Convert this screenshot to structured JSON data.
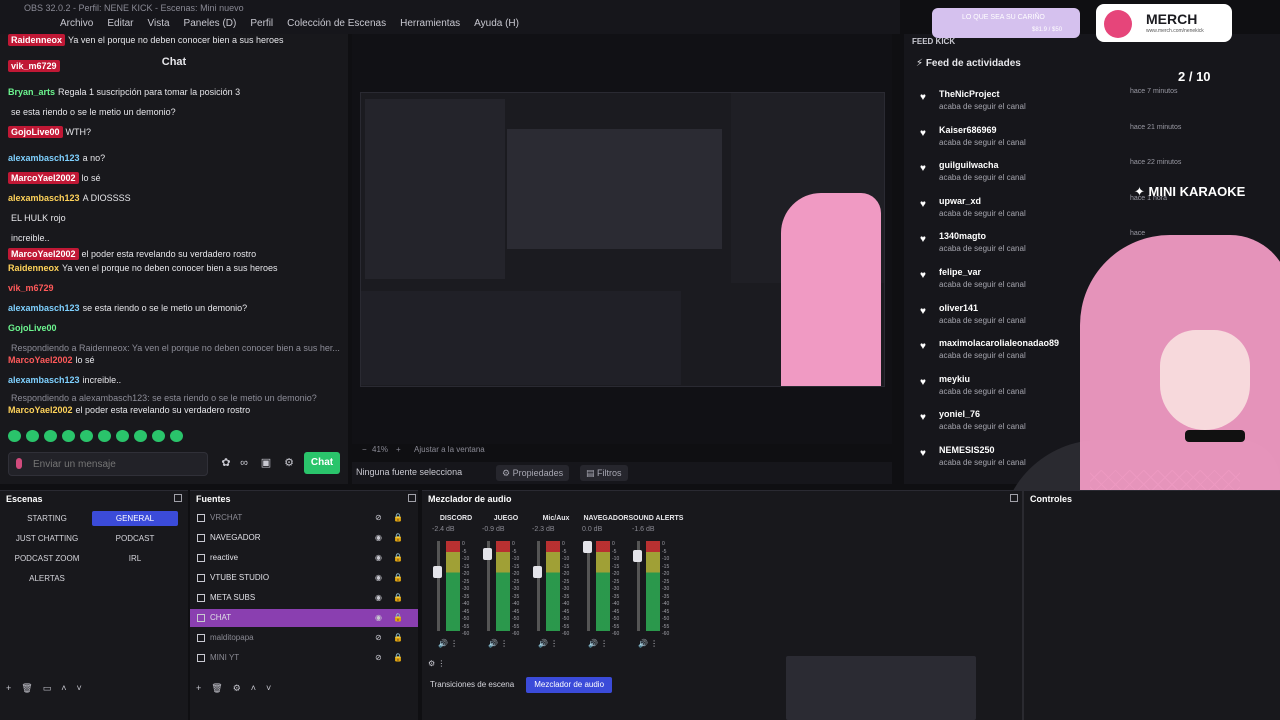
{
  "window_title": "OBS 32.0.2 - Perfil: NENE KICK - Escenas: Mini nuevo",
  "menu": [
    "Archivo",
    "Editar",
    "Vista",
    "Paneles (D)",
    "Perfil",
    "Colección de Escenas",
    "Herramientas",
    "Ayuda (H)"
  ],
  "chat": {
    "title": "Chat",
    "lines": [
      {
        "user": "Raidenneox",
        "text": "Ya ven el porque no deben conocer bien a sus heroes",
        "kind": "badge"
      },
      {
        "user": "vik_m6729",
        "text": "",
        "kind": "badge"
      },
      {
        "user": "Bryan_arts",
        "text": "Regala 1 suscripción para tomar la posición 3",
        "kind": "normal"
      },
      {
        "user": "",
        "text": "se esta riendo o se le metio un demonio?",
        "kind": "normal"
      },
      {
        "user": "GojoLive00",
        "text": "WTH?",
        "kind": "badge"
      },
      {
        "user": "alexambasch123",
        "text": "a no?",
        "kind": "normal"
      },
      {
        "user": "MarcoYael2002",
        "text": "lo sé",
        "kind": "badge"
      },
      {
        "user": "alexambasch123",
        "text": "A DIOSSSS",
        "kind": "normal"
      },
      {
        "user": "",
        "text": "EL HULK rojo",
        "kind": "normal"
      },
      {
        "user": "",
        "text": "increible..",
        "kind": "normal"
      },
      {
        "user": "MarcoYael2002",
        "text": "el poder esta revelando su verdadero rostro",
        "kind": "badge"
      },
      {
        "user": "Raidenneox",
        "text": "Ya ven el porque no deben conocer bien a sus heroes",
        "kind": "normal"
      },
      {
        "user": "vik_m6729",
        "text": "",
        "kind": "normal"
      },
      {
        "user": "alexambasch123",
        "text": "se esta riendo o se le metio un demonio?",
        "kind": "normal"
      },
      {
        "user": "GojoLive00",
        "text": "",
        "kind": "normal"
      },
      {
        "user": "",
        "text": "Respondiendo a Raidenneox: Ya ven el porque no deben conocer bien a sus her...",
        "kind": "reply"
      },
      {
        "user": "MarcoYael2002",
        "text": "lo sé",
        "kind": "normal"
      },
      {
        "user": "alexambasch123",
        "text": "increible..",
        "kind": "normal"
      },
      {
        "user": "",
        "text": "Respondiendo a alexambasch123: se esta riendo o se le metio un demonio?",
        "kind": "reply"
      },
      {
        "user": "MarcoYael2002",
        "text": "el poder esta revelando su verdadero rostro",
        "kind": "normal"
      }
    ],
    "input_placeholder": "Enviar un mensaje",
    "send_label": "Chat"
  },
  "preview": {
    "zoom": "41%",
    "fit_label": "Ajustar a la ventana",
    "no_source": "Ninguna fuente selecciona",
    "properties_label": "Propiedades",
    "filters_label": "Filtros"
  },
  "merch": {
    "goal_text": "LO QUE SEA SU CARIÑO",
    "goal_amount": "$81.9 / $50",
    "title": "MERCH",
    "url": "www.merch.com/nenekick"
  },
  "feed": {
    "header": "FEED KICK",
    "title": "Feed de actividades",
    "items": [
      {
        "name": "TheNicProject",
        "action": "acaba de seguir el canal",
        "time": "hace 7 minutos"
      },
      {
        "name": "Kaiser686969",
        "action": "acaba de seguir el canal",
        "time": "hace 21 minutos"
      },
      {
        "name": "guilguilwacha",
        "action": "acaba de seguir el canal",
        "time": "hace 22 minutos"
      },
      {
        "name": "upwar_xd",
        "action": "acaba de seguir el canal",
        "time": "hace 1 hora"
      },
      {
        "name": "1340magto",
        "action": "acaba de seguir el canal",
        "time": "hace"
      },
      {
        "name": "felipe_var",
        "action": "acaba de seguir el canal",
        "time": ""
      },
      {
        "name": "oliver141",
        "action": "acaba de seguir el canal",
        "time": ""
      },
      {
        "name": "maximolacarolialeonadao89",
        "action": "acaba de seguir el canal",
        "time": ""
      },
      {
        "name": "meykiu",
        "action": "acaba de seguir el canal",
        "time": ""
      },
      {
        "name": "yoniel_76",
        "action": "acaba de seguir el canal",
        "time": ""
      },
      {
        "name": "NEMESIS250",
        "action": "acaba de seguir el canal",
        "time": ""
      }
    ]
  },
  "karaoke": {
    "count": "2 / 10",
    "title": "MINI KARAOKE"
  },
  "scenes": {
    "title": "Escenas",
    "items": [
      "STARTING",
      "GENERAL",
      "JUST CHATTING",
      "PODCAST",
      "PODCAST ZOOM",
      "IRL",
      "ALERTAS"
    ],
    "active": "GENERAL"
  },
  "sources": {
    "title": "Fuentes",
    "items": [
      {
        "name": "VRCHAT",
        "visible": false
      },
      {
        "name": "NAVEGADOR",
        "visible": true
      },
      {
        "name": "reactive",
        "visible": true
      },
      {
        "name": "VTUBE STUDIO",
        "visible": true
      },
      {
        "name": "META SUBS",
        "visible": true
      },
      {
        "name": "CHAT",
        "visible": true
      },
      {
        "name": "malditopapa",
        "visible": false
      },
      {
        "name": "MINI YT",
        "visible": false
      }
    ],
    "active": "CHAT"
  },
  "mixer": {
    "title": "Mezclador de audio",
    "channels": [
      {
        "name": "DISCORD",
        "db": "-2.4 dB",
        "level": 0.28
      },
      {
        "name": "JUEGO",
        "db": "-0.9 dB",
        "level": 0.08
      },
      {
        "name": "Mic/Aux",
        "db": "-2.3 dB",
        "level": 0.28
      },
      {
        "name": "NAVEGADOR",
        "db": "0.0 dB",
        "level": 0.0
      },
      {
        "name": "SOUND ALERTS",
        "db": "-1.6 dB",
        "level": 0.1
      }
    ],
    "scale": [
      "0",
      "-5",
      "-10",
      "-15",
      "-20",
      "-25",
      "-30",
      "-35",
      "-40",
      "-45",
      "-50",
      "-55",
      "-60"
    ],
    "tab_transitions": "Transiciones de escena",
    "tab_mixer": "Mezclador de audio"
  },
  "controls": {
    "title": "Controles"
  }
}
